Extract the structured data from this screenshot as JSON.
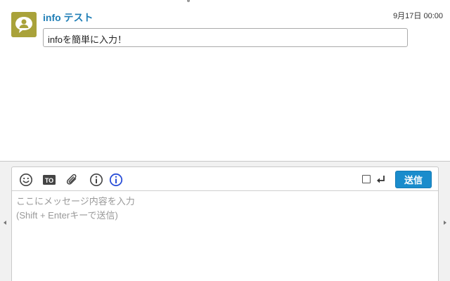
{
  "timeline": {
    "message": {
      "sender": "info テスト",
      "timestamp": "9月17日 00:00",
      "body": "infoを簡単に入力！",
      "avatar_icon": "chat-bubble-person-icon",
      "avatar_color": "#a9a23a"
    }
  },
  "composer": {
    "toolbar": {
      "emoji_icon": "emoji-icon",
      "to_icon": "to-icon",
      "to_label": "TO",
      "attach_icon": "paperclip-icon",
      "info_icon": "info-icon",
      "info_blue_icon": "info-blue-icon",
      "enter_icon": "enter-return-icon",
      "send_label": "送信"
    },
    "input": {
      "value": "",
      "placeholder": "ここにメッセージ内容を入力\n(Shift + Enterキーで送信)"
    }
  },
  "colors": {
    "sender": "#1f7eb6",
    "send_button": "#1a8ccc",
    "info_blue": "#2b4fd8"
  }
}
